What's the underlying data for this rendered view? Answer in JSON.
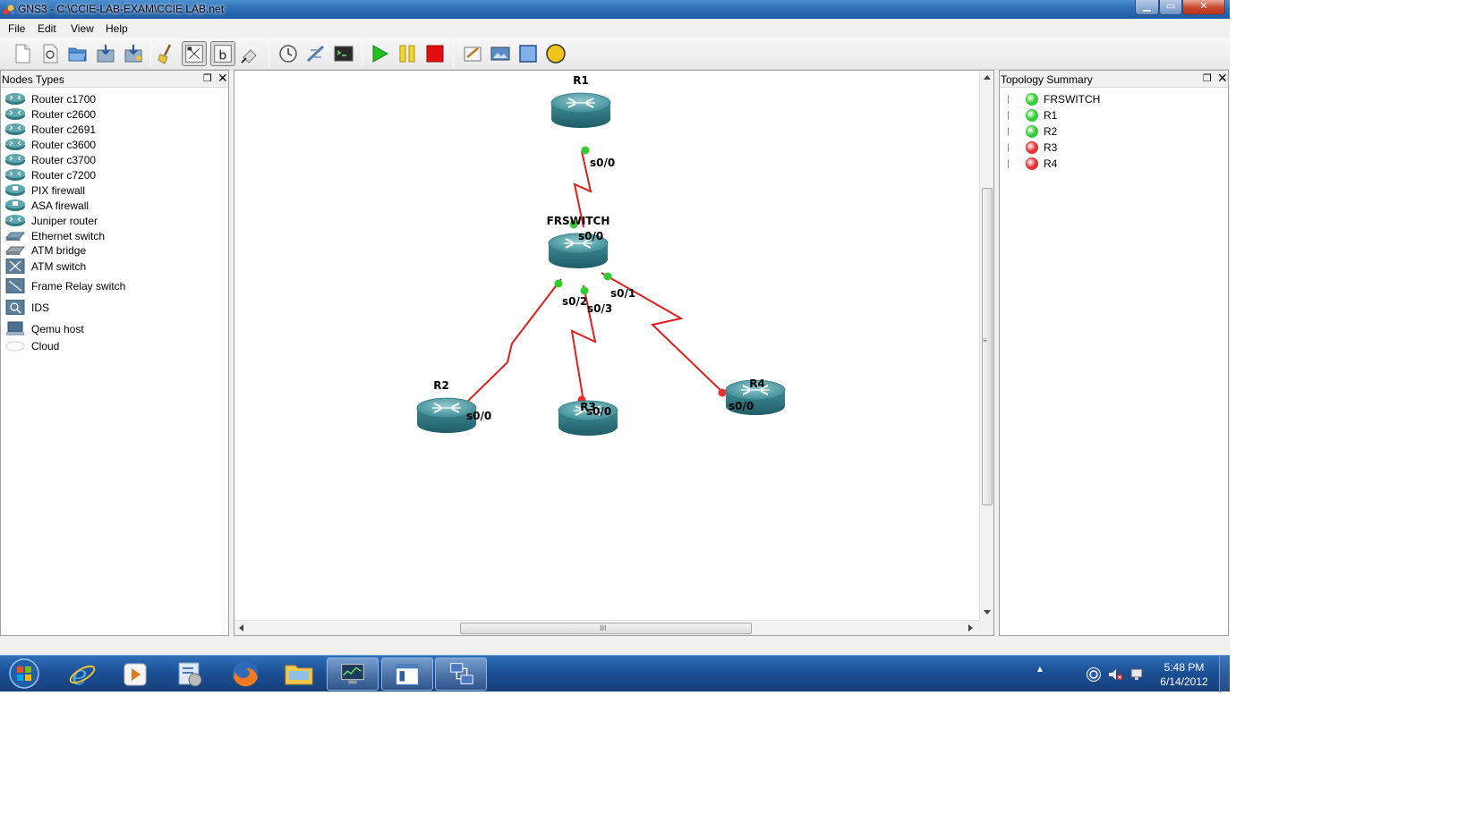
{
  "window": {
    "title": "GNS3 - C:\\CCIE-LAB-EXAM\\CCIE LAB.net",
    "min_glyph": "▁",
    "max_glyph": "▭",
    "close_glyph": "✕"
  },
  "menu": {
    "items": [
      "File",
      "Edit",
      "View",
      "Help"
    ]
  },
  "toolbar": {
    "buttons": [
      "new-project",
      "open-file",
      "open-project",
      "save",
      "save-as",
      "clear",
      "show-interface-labels",
      "show-hostnames",
      "add-link",
      "console-all",
      "capture",
      "terminal",
      "start-all",
      "suspend-all",
      "stop-all",
      "add-note",
      "insert-picture",
      "draw-rectangle",
      "draw-ellipse"
    ]
  },
  "nodes_panel": {
    "title": "Nodes Types",
    "float_glyph": "❐",
    "close_glyph": "✕",
    "items": [
      {
        "label": "Router c1700",
        "icon": "router-icon"
      },
      {
        "label": "Router c2600",
        "icon": "router-icon"
      },
      {
        "label": "Router c2691",
        "icon": "router-icon"
      },
      {
        "label": "Router c3600",
        "icon": "router-icon"
      },
      {
        "label": "Router c3700",
        "icon": "router-icon"
      },
      {
        "label": "Router c7200",
        "icon": "router-icon"
      },
      {
        "label": "PIX firewall",
        "icon": "firewall-icon"
      },
      {
        "label": "ASA firewall",
        "icon": "firewall-icon"
      },
      {
        "label": "Juniper router",
        "icon": "router-icon"
      },
      {
        "label": "Ethernet switch",
        "icon": "switch-icon"
      },
      {
        "label": "ATM bridge",
        "icon": "bridge-icon"
      },
      {
        "label": "ATM switch",
        "icon": "atm-switch-icon"
      },
      {
        "label": "Frame Relay switch",
        "icon": "frame-relay-switch-icon"
      },
      {
        "label": "IDS",
        "icon": "ids-icon"
      },
      {
        "label": "Qemu host",
        "icon": "host-icon"
      },
      {
        "label": "Cloud",
        "icon": "cloud-icon"
      }
    ]
  },
  "topology_panel": {
    "title": "Topology Summary",
    "float_glyph": "❐",
    "close_glyph": "✕",
    "items": [
      {
        "label": "FRSWITCH",
        "status": "running"
      },
      {
        "label": "R1",
        "status": "running"
      },
      {
        "label": "R2",
        "status": "running"
      },
      {
        "label": "R3",
        "status": "stopped"
      },
      {
        "label": "R4",
        "status": "stopped"
      }
    ]
  },
  "status_colors": {
    "running": "#33cc33",
    "stopped": "#e83030",
    "link": "#e01e1e"
  },
  "topology": {
    "nodes": {
      "R1": "R1",
      "FRSWITCH": "FRSWITCH",
      "R2": "R2",
      "R3": "R3",
      "R4": "R4"
    },
    "links": [
      {
        "from": "R1",
        "from_port": "s0/0",
        "to": "FRSWITCH",
        "to_port": "s0/0",
        "status": "up"
      },
      {
        "from": "FRSWITCH",
        "from_port": "s0/2",
        "to": "R2",
        "to_port": "s0/0",
        "status": "up"
      },
      {
        "from": "FRSWITCH",
        "from_port": "s0/3",
        "to": "R3",
        "to_port": "s0/0",
        "status": "down"
      },
      {
        "from": "FRSWITCH",
        "from_port": "s0/1",
        "to": "R4",
        "to_port": "s0/0",
        "status": "down"
      }
    ]
  },
  "scrollbars": {
    "grip": "III"
  },
  "taskbar": {
    "apps": [
      "start-orb",
      "internet-explorer",
      "media-player",
      "control-panel",
      "firefox",
      "file-explorer",
      "network-monitor",
      "notepad",
      "gns3"
    ],
    "tray_arrow": "▲",
    "time": "5:48 PM",
    "date": "6/14/2012"
  }
}
